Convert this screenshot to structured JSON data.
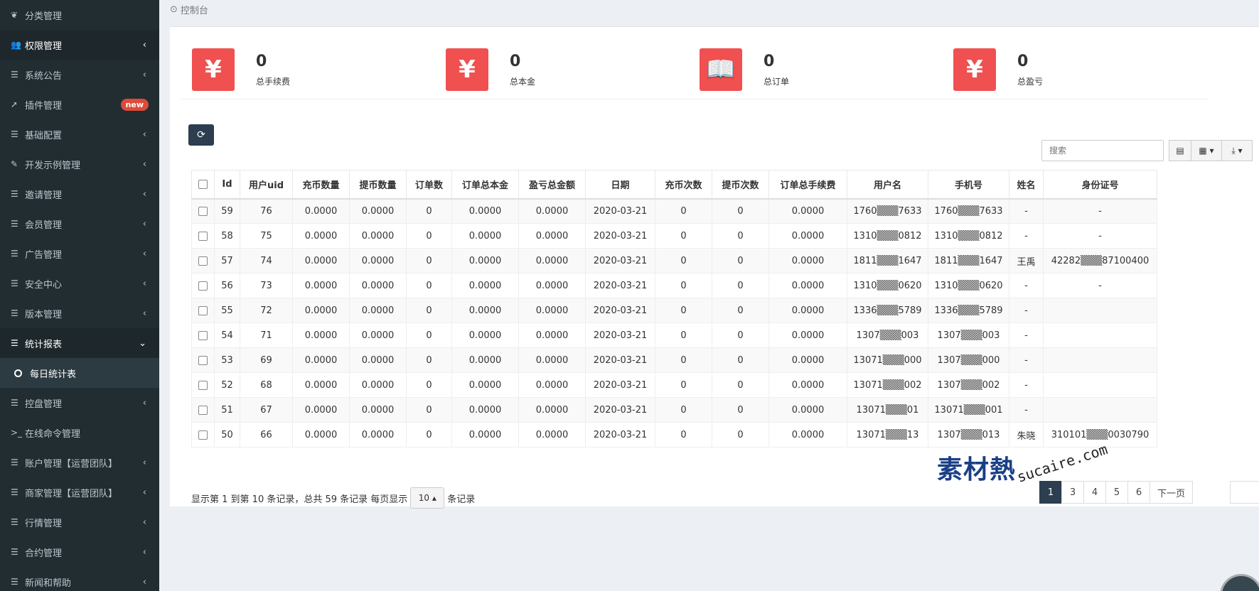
{
  "sidebar": {
    "items": [
      {
        "label": "分类管理",
        "icon": "leaf-icon",
        "glyph": "❦",
        "chevron": "",
        "badge": ""
      },
      {
        "label": "权限管理",
        "icon": "users-icon",
        "glyph": "👥",
        "chevron": "‹",
        "badge": "",
        "active": true
      },
      {
        "label": "系统公告",
        "icon": "list-icon",
        "glyph": "☰",
        "chevron": "‹",
        "badge": ""
      },
      {
        "label": "插件管理",
        "icon": "rocket-icon",
        "glyph": "➚",
        "chevron": "",
        "badge": "new"
      },
      {
        "label": "基础配置",
        "icon": "list-icon",
        "glyph": "☰",
        "chevron": "‹",
        "badge": ""
      },
      {
        "label": "开发示例管理",
        "icon": "magic-icon",
        "glyph": "✎",
        "chevron": "‹",
        "badge": ""
      },
      {
        "label": "邀请管理",
        "icon": "list-icon",
        "glyph": "☰",
        "chevron": "‹",
        "badge": ""
      },
      {
        "label": "会员管理",
        "icon": "list-icon",
        "glyph": "☰",
        "chevron": "‹",
        "badge": ""
      },
      {
        "label": "广告管理",
        "icon": "list-icon",
        "glyph": "☰",
        "chevron": "‹",
        "badge": ""
      },
      {
        "label": "安全中心",
        "icon": "list-icon",
        "glyph": "☰",
        "chevron": "‹",
        "badge": ""
      },
      {
        "label": "版本管理",
        "icon": "list-icon",
        "glyph": "☰",
        "chevron": "‹",
        "badge": ""
      },
      {
        "label": "统计报表",
        "icon": "list-icon",
        "glyph": "☰",
        "chevron": "⌄",
        "badge": "",
        "active": true
      },
      {
        "label": "每日统计表",
        "icon": "circle-icon",
        "glyph": "",
        "chevron": "",
        "badge": "",
        "sub": true
      },
      {
        "label": "控盘管理",
        "icon": "list-icon",
        "glyph": "☰",
        "chevron": "‹",
        "badge": ""
      },
      {
        "label": "在线命令管理",
        "icon": "terminal-icon",
        "glyph": ">_",
        "chevron": "",
        "badge": ""
      },
      {
        "label": "账户管理【运营团队】",
        "icon": "list-icon",
        "glyph": "☰",
        "chevron": "‹",
        "badge": ""
      },
      {
        "label": "商家管理【运营团队】",
        "icon": "list-icon",
        "glyph": "☰",
        "chevron": "‹",
        "badge": ""
      },
      {
        "label": "行情管理",
        "icon": "list-icon",
        "glyph": "☰",
        "chevron": "‹",
        "badge": ""
      },
      {
        "label": "合约管理",
        "icon": "list-icon",
        "glyph": "☰",
        "chevron": "‹",
        "badge": ""
      },
      {
        "label": "新闻和帮助",
        "icon": "list-icon",
        "glyph": "☰",
        "chevron": "‹",
        "badge": ""
      }
    ]
  },
  "breadcrumb": {
    "icon": "dashboard-icon",
    "label": "控制台"
  },
  "stats": [
    {
      "value": "0",
      "label": "总手续费",
      "icon": "yen-icon",
      "glyph": "¥"
    },
    {
      "value": "0",
      "label": "总本金",
      "icon": "yen-icon",
      "glyph": "¥"
    },
    {
      "value": "0",
      "label": "总订单",
      "icon": "book-icon",
      "glyph": "📖"
    },
    {
      "value": "0",
      "label": "总盈亏",
      "icon": "yen-icon",
      "glyph": "¥"
    }
  ],
  "toolbar": {
    "refresh_glyph": "⟳",
    "search_placeholder": "搜索"
  },
  "table": {
    "headers": [
      "Id",
      "用户uid",
      "充币数量",
      "提币数量",
      "订单数",
      "订单总本金",
      "盈亏总金额",
      "日期",
      "充币次数",
      "提币次数",
      "订单总手续费",
      "用户名",
      "手机号",
      "姓名",
      "身份证号"
    ],
    "rows": [
      [
        "59",
        "76",
        "0.0000",
        "0.0000",
        "0",
        "0.0000",
        "0.0000",
        "2020-03-21",
        "0",
        "0",
        "0.0000",
        "1760▒▒▒7633",
        "1760▒▒▒7633",
        "-",
        "-"
      ],
      [
        "58",
        "75",
        "0.0000",
        "0.0000",
        "0",
        "0.0000",
        "0.0000",
        "2020-03-21",
        "0",
        "0",
        "0.0000",
        "1310▒▒▒0812",
        "1310▒▒▒0812",
        "-",
        "-"
      ],
      [
        "57",
        "74",
        "0.0000",
        "0.0000",
        "0",
        "0.0000",
        "0.0000",
        "2020-03-21",
        "0",
        "0",
        "0.0000",
        "1811▒▒▒1647",
        "1811▒▒▒1647",
        "王禹",
        "42282▒▒▒87100400"
      ],
      [
        "56",
        "73",
        "0.0000",
        "0.0000",
        "0",
        "0.0000",
        "0.0000",
        "2020-03-21",
        "0",
        "0",
        "0.0000",
        "1310▒▒▒0620",
        "1310▒▒▒0620",
        "-",
        "-"
      ],
      [
        "55",
        "72",
        "0.0000",
        "0.0000",
        "0",
        "0.0000",
        "0.0000",
        "2020-03-21",
        "0",
        "0",
        "0.0000",
        "1336▒▒▒5789",
        "1336▒▒▒5789",
        "-",
        ""
      ],
      [
        "54",
        "71",
        "0.0000",
        "0.0000",
        "0",
        "0.0000",
        "0.0000",
        "2020-03-21",
        "0",
        "0",
        "0.0000",
        "1307▒▒▒003",
        "1307▒▒▒003",
        "-",
        ""
      ],
      [
        "53",
        "69",
        "0.0000",
        "0.0000",
        "0",
        "0.0000",
        "0.0000",
        "2020-03-21",
        "0",
        "0",
        "0.0000",
        "13071▒▒▒000",
        "1307▒▒▒000",
        "-",
        ""
      ],
      [
        "52",
        "68",
        "0.0000",
        "0.0000",
        "0",
        "0.0000",
        "0.0000",
        "2020-03-21",
        "0",
        "0",
        "0.0000",
        "13071▒▒▒002",
        "1307▒▒▒002",
        "-",
        ""
      ],
      [
        "51",
        "67",
        "0.0000",
        "0.0000",
        "0",
        "0.0000",
        "0.0000",
        "2020-03-21",
        "0",
        "0",
        "0.0000",
        "13071▒▒▒01",
        "13071▒▒▒001",
        "-",
        ""
      ],
      [
        "50",
        "66",
        "0.0000",
        "0.0000",
        "0",
        "0.0000",
        "0.0000",
        "2020-03-21",
        "0",
        "0",
        "0.0000",
        "13071▒▒▒13",
        "1307▒▒▒013",
        "朱晓",
        "310101▒▒▒0030790"
      ]
    ]
  },
  "pagination": {
    "info_prefix": "显示第 1 到第 10 条记录，总共 59 条记录 每页显示",
    "page_size": "10 ▴",
    "info_suffix": "条记录",
    "pages": [
      "1",
      "3",
      "4",
      "5",
      "6"
    ],
    "next": "下一页"
  },
  "watermark": {
    "cn": "素材熱",
    "en": "sucaire.com"
  },
  "colors": {
    "sidebar": "#222d32",
    "accent_red": "#f05050",
    "dark_btn": "#2c3e50"
  }
}
